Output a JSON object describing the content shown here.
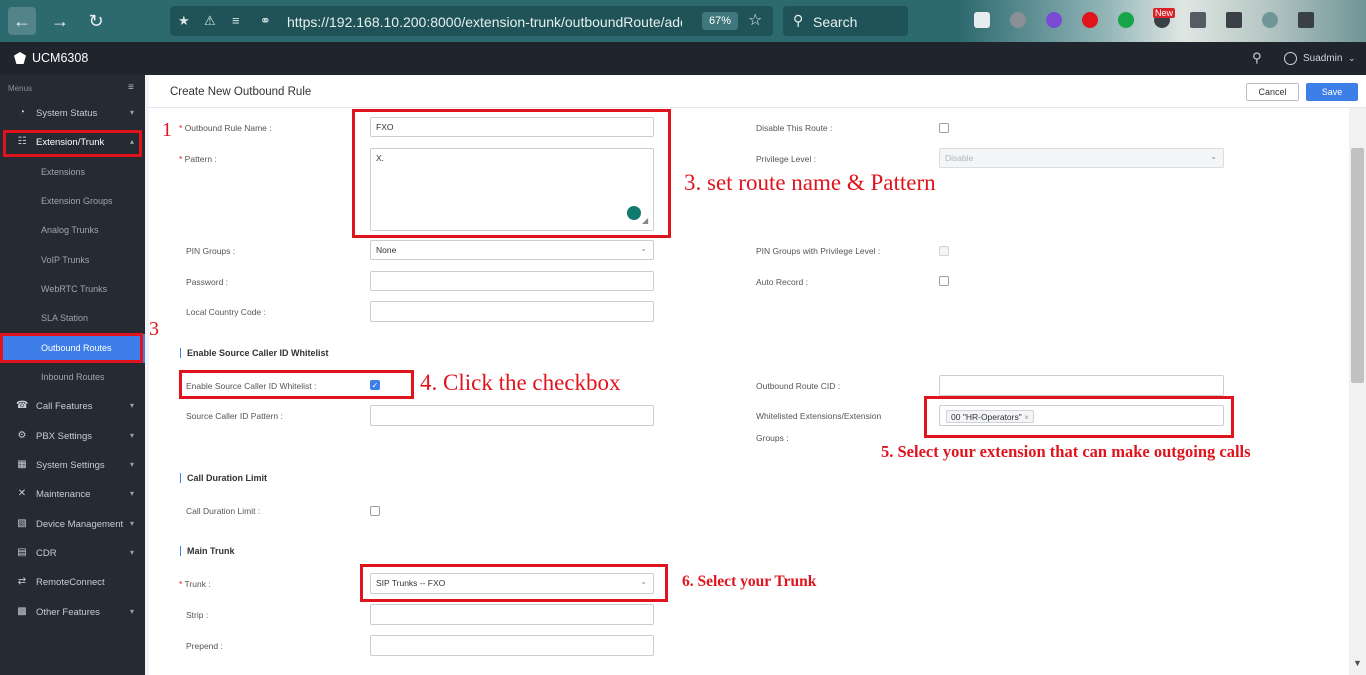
{
  "browser": {
    "url": "https://192.168.10.200:8000/extension-trunk/outboundRoute/add",
    "zoom": "67%",
    "search_placeholder": "Search",
    "new_badge": "New"
  },
  "app": {
    "title": "UCM6308",
    "username": "Suadmin"
  },
  "sidebar": {
    "menus_label": "Menus",
    "items": [
      {
        "label": "System Status"
      },
      {
        "label": "Extension/Trunk"
      },
      {
        "label": "Call Features"
      },
      {
        "label": "PBX Settings"
      },
      {
        "label": "System Settings"
      },
      {
        "label": "Maintenance"
      },
      {
        "label": "Device Management"
      },
      {
        "label": "CDR"
      },
      {
        "label": "RemoteConnect"
      },
      {
        "label": "Other Features"
      }
    ],
    "subitems": [
      {
        "label": "Extensions"
      },
      {
        "label": "Extension Groups"
      },
      {
        "label": "Analog Trunks"
      },
      {
        "label": "VoIP Trunks"
      },
      {
        "label": "WebRTC Trunks"
      },
      {
        "label": "SLA Station"
      },
      {
        "label": "Outbound Routes"
      },
      {
        "label": "Inbound Routes"
      }
    ]
  },
  "page": {
    "title": "Create New Outbound Rule",
    "cancel_label": "Cancel",
    "save_label": "Save"
  },
  "form": {
    "outbound_rule_name": {
      "label": "Outbound Rule Name :",
      "value": "FXO"
    },
    "pattern": {
      "label": "Pattern :",
      "value": "X."
    },
    "disable_route": {
      "label": "Disable This Route :",
      "checked": false
    },
    "privilege_level": {
      "label": "Privilege Level :",
      "value": "Disable"
    },
    "pin_groups": {
      "label": "PIN Groups :",
      "value": "None"
    },
    "pin_groups_privilege": {
      "label": "PIN Groups with Privilege Level :",
      "checked": false
    },
    "password": {
      "label": "Password :",
      "value": ""
    },
    "auto_record": {
      "label": "Auto Record :",
      "checked": false
    },
    "local_country_code": {
      "label": "Local Country Code :",
      "value": ""
    },
    "section_whitelist": "Enable Source Caller ID Whitelist",
    "enable_whitelist": {
      "label": "Enable Source Caller ID Whitelist :",
      "checked": true
    },
    "outbound_route_cid": {
      "label": "Outbound Route CID :",
      "value": ""
    },
    "source_caller_pattern": {
      "label": "Source Caller ID Pattern :",
      "value": ""
    },
    "whitelisted_extensions": {
      "label_line1": "Whitelisted Extensions/Extension",
      "label_line2": "Groups :",
      "tag": "00 \"HR-Operators\"",
      "tag_remove": "×"
    },
    "section_duration": "Call Duration Limit",
    "call_duration_limit": {
      "label": "Call Duration Limit :",
      "checked": false
    },
    "section_main_trunk": "Main Trunk",
    "trunk": {
      "label": "Trunk :",
      "value": "SIP Trunks -- FXO"
    },
    "strip": {
      "label": "Strip :",
      "value": ""
    },
    "prepend": {
      "label": "Prepend :",
      "value": ""
    }
  },
  "annotations": {
    "num_1": "1",
    "num_3": "3",
    "step_3": "3. set route name & Pattern",
    "step_4": "4. Click the checkbox",
    "step_5": "5. Select your extension that can make outgoing calls",
    "step_6": "6. Select your Trunk"
  },
  "colors": {
    "accent": "#3e7ee8",
    "annotation_red": "#e0141d",
    "browser_bar": "#2d6a70",
    "app_header": "#20242c",
    "sidebar_bg": "#262b33"
  }
}
